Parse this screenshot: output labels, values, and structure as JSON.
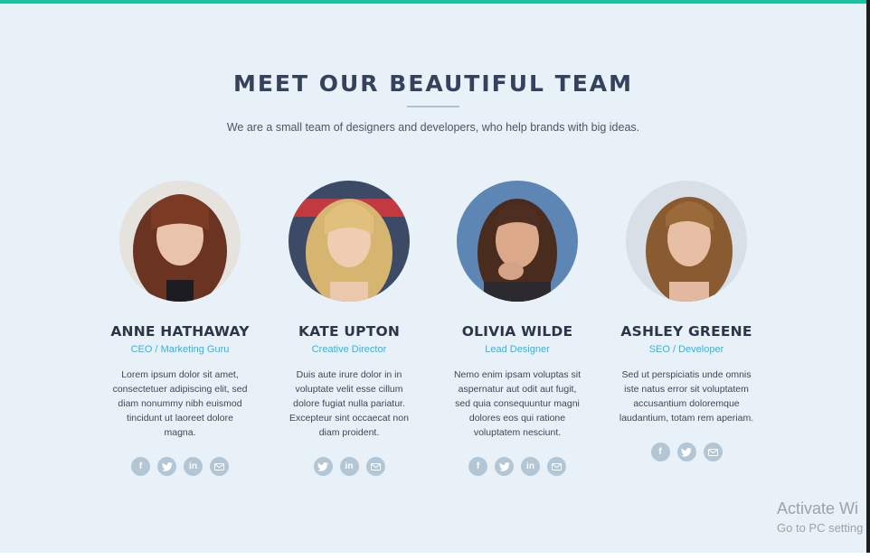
{
  "section": {
    "title": "MEET OUR BEAUTIFUL TEAM",
    "subtitle": "We are a small team of designers and developers, who help brands with big ideas."
  },
  "colors": {
    "accent_bar": "#1bc2a0",
    "background": "#e8f1f8",
    "heading": "#34425d",
    "role": "#2eb5e0",
    "social_icon_bg": "#b3c6d5"
  },
  "team": [
    {
      "name": "ANNE HATHAWAY",
      "role": "CEO / Marketing Guru",
      "bio": "Lorem ipsum dolor sit amet, consectetuer adipiscing elit, sed diam nonummy nibh euismod tincidunt ut laoreet dolore magna.",
      "socials": [
        "facebook-icon",
        "twitter-icon",
        "linkedin-icon",
        "email-icon"
      ]
    },
    {
      "name": "KATE UPTON",
      "role": "Creative Director",
      "bio": "Duis aute irure dolor in in voluptate velit esse cillum dolore fugiat nulla pariatur. Excepteur sint occaecat non diam proident.",
      "socials": [
        "twitter-icon",
        "linkedin-icon",
        "email-icon"
      ]
    },
    {
      "name": "OLIVIA WILDE",
      "role": "Lead Designer",
      "bio": "Nemo enim ipsam voluptas sit aspernatur aut odit aut fugit, sed quia consequuntur magni dolores eos qui ratione voluptatem nesciunt.",
      "socials": [
        "facebook-icon",
        "twitter-icon",
        "linkedin-icon",
        "email-icon"
      ]
    },
    {
      "name": "ASHLEY GREENE",
      "role": "SEO / Developer",
      "bio": "Sed ut perspiciatis unde omnis iste natus error sit voluptatem accusantium doloremque laudantium, totam rem aperiam.",
      "socials": [
        "facebook-icon",
        "twitter-icon",
        "email-icon"
      ]
    }
  ],
  "watermark": {
    "line1": "Activate Wi",
    "line2": "Go to PC setting"
  }
}
